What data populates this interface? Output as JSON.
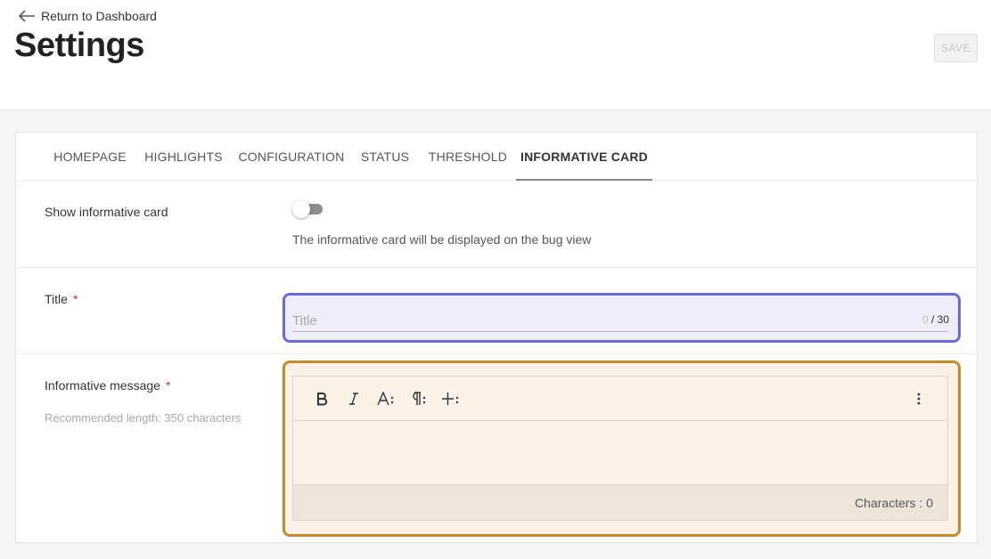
{
  "header": {
    "back_label": "Return to Dashboard",
    "title": "Settings",
    "save_label": "SAVE"
  },
  "tabs": [
    {
      "label": "HOMEPAGE",
      "active": false
    },
    {
      "label": "HIGHLIGHTS",
      "active": false
    },
    {
      "label": "CONFIGURATION",
      "active": false
    },
    {
      "label": "STATUS",
      "active": false
    },
    {
      "label": "THRESHOLD",
      "active": false
    },
    {
      "label": "INFORMATIVE CARD",
      "active": true
    }
  ],
  "show_card": {
    "label": "Show informative card",
    "enabled": false,
    "description": "The informative card will be displayed on the bug view"
  },
  "title_field": {
    "label": "Title",
    "required_mark": "*",
    "placeholder": "Title",
    "value": "",
    "count": "0",
    "max": "/ 30"
  },
  "message_field": {
    "label": "Informative message",
    "required_mark": "*",
    "hint": "Recommended length: 350 characters",
    "toolbar": [
      "bold-icon",
      "italic-icon",
      "font-size-icon",
      "paragraph-icon",
      "insert-icon",
      "more-options-icon"
    ],
    "char_count": "Characters : 0"
  },
  "colors": {
    "title_highlight": "#6a6ad8",
    "message_highlight": "#c48a2c",
    "required": "#d0312d"
  }
}
